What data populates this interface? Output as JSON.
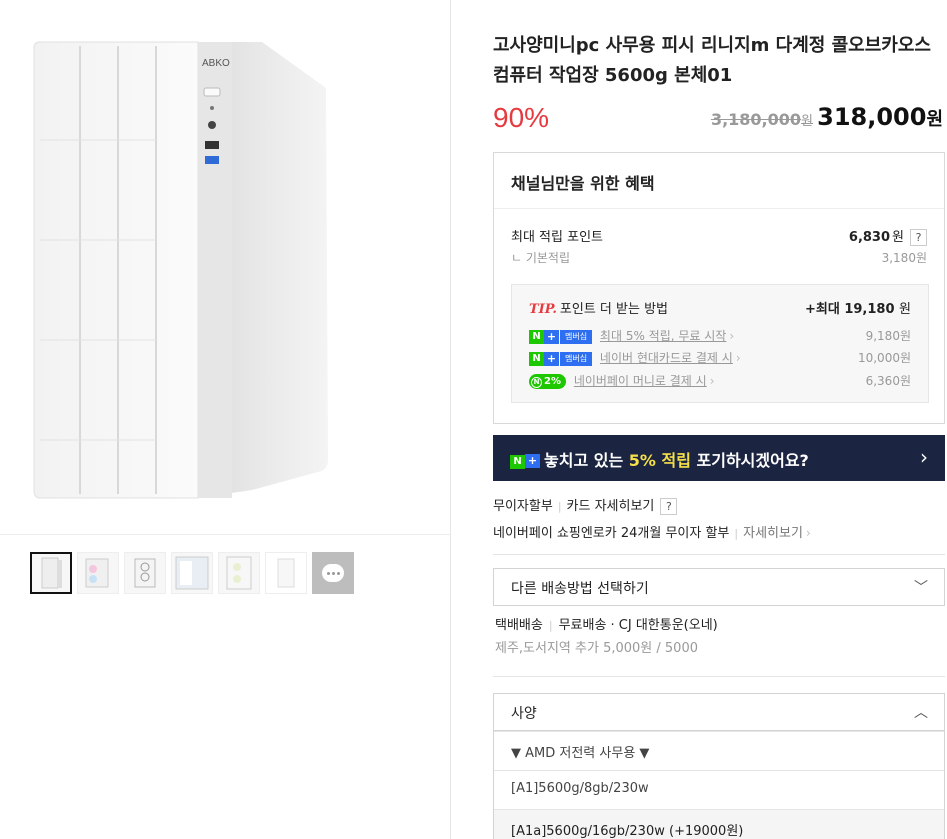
{
  "product": {
    "title": "고사양미니pc 사무용 피시 리니지m 다계정 콜오브카오스 컴퓨터 작업장 5600g 본체01",
    "image_brand": "ABKO",
    "discount": "90%",
    "original_price": "3,180,000",
    "original_unit": "원",
    "sale_price": "318,000",
    "sale_unit": "원"
  },
  "benefit": {
    "heading": "채널님만을 위한 혜택",
    "max_points_label": "최대 적립 포인트",
    "max_points_value": "6,830",
    "max_points_unit": "원",
    "help": "?",
    "base_label": "ㄴ 기본적립",
    "base_value": "3,180원",
    "tip": {
      "tip_word": "TIP.",
      "heading": "포인트 더 받는 방법",
      "max_label": "+최대 19,180",
      "max_unit": "원",
      "items": [
        {
          "badge_n": "N",
          "badge_plus": "+",
          "badge_mem": "멤버십",
          "text": "최대 5% 적립, 무료 시작",
          "amount": "9,180원"
        },
        {
          "badge_n": "N",
          "badge_plus": "+",
          "badge_mem": "멤버십",
          "text": "네이버 현대카드로 결제 시",
          "amount": "10,000원"
        },
        {
          "badge_pay": "2%",
          "badge_pay_n": "N",
          "text": "네이버페이 머니로 결제 시",
          "amount": "6,360원"
        }
      ]
    }
  },
  "banner": {
    "badge_n": "N",
    "badge_plus": "+",
    "pre": "놓치고 있는 ",
    "highlight": "5% 적립",
    "post": " 포기하시겠어요?",
    "arrow": "›"
  },
  "installment": {
    "line1_a": "무이자할부",
    "line1_b": "카드 자세히보기",
    "help": "?",
    "line2_a": "네이버페이 쇼핑엔로카 24개월 무이자 할부",
    "line2_b": "자세히보기",
    "chev": "›"
  },
  "delivery": {
    "select_label": "다른 배송방법 선택하기",
    "method": "택배배송",
    "fee": "무료배송 · CJ 대한통운(오네)",
    "extra": "제주,도서지역 추가 5,000원 / 5000"
  },
  "options": {
    "label": "사양",
    "items": [
      "▼ AMD 저전력 사무용 ▼",
      "[A1]5600g/8gb/230w",
      "[A1a]5600g/16gb/230w (+19000원)"
    ]
  },
  "colors": {
    "discount_red": "#e53a40",
    "banner_navy": "#1b2441",
    "naver_green": "#1ec800",
    "highlight_yellow": "#f5e04a"
  },
  "thumbnails_count": 7
}
